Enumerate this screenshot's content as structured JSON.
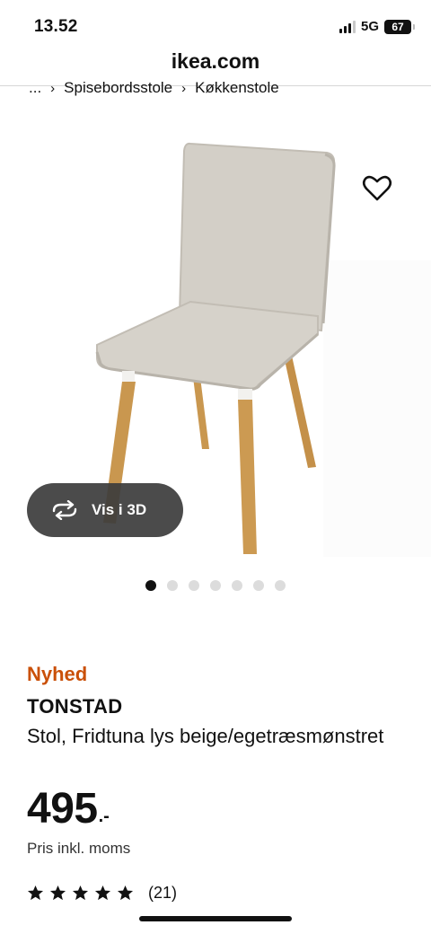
{
  "status_bar": {
    "time": "13.52",
    "network": "5G",
    "battery": "67"
  },
  "browser": {
    "url": "ikea.com"
  },
  "breadcrumb": {
    "items": [
      "...",
      "Spisebordsstole",
      "Køkkenstole"
    ],
    "separator": "›"
  },
  "gallery": {
    "view_3d_label": "Vis i 3D",
    "dot_count": 7,
    "active_index": 0
  },
  "product": {
    "badge": "Nyhed",
    "name": "TONSTAD",
    "description": "Stol, Fridtuna lys beige/egetræsmønstret",
    "price": "495",
    "price_suffix": ".-",
    "price_note": "Pris inkl. moms",
    "rating": {
      "stars": 5,
      "count": "(21)"
    }
  },
  "colors": {
    "badge": "#ca5008",
    "upholstery": "#d2cec6",
    "legs": "#c9974f"
  }
}
